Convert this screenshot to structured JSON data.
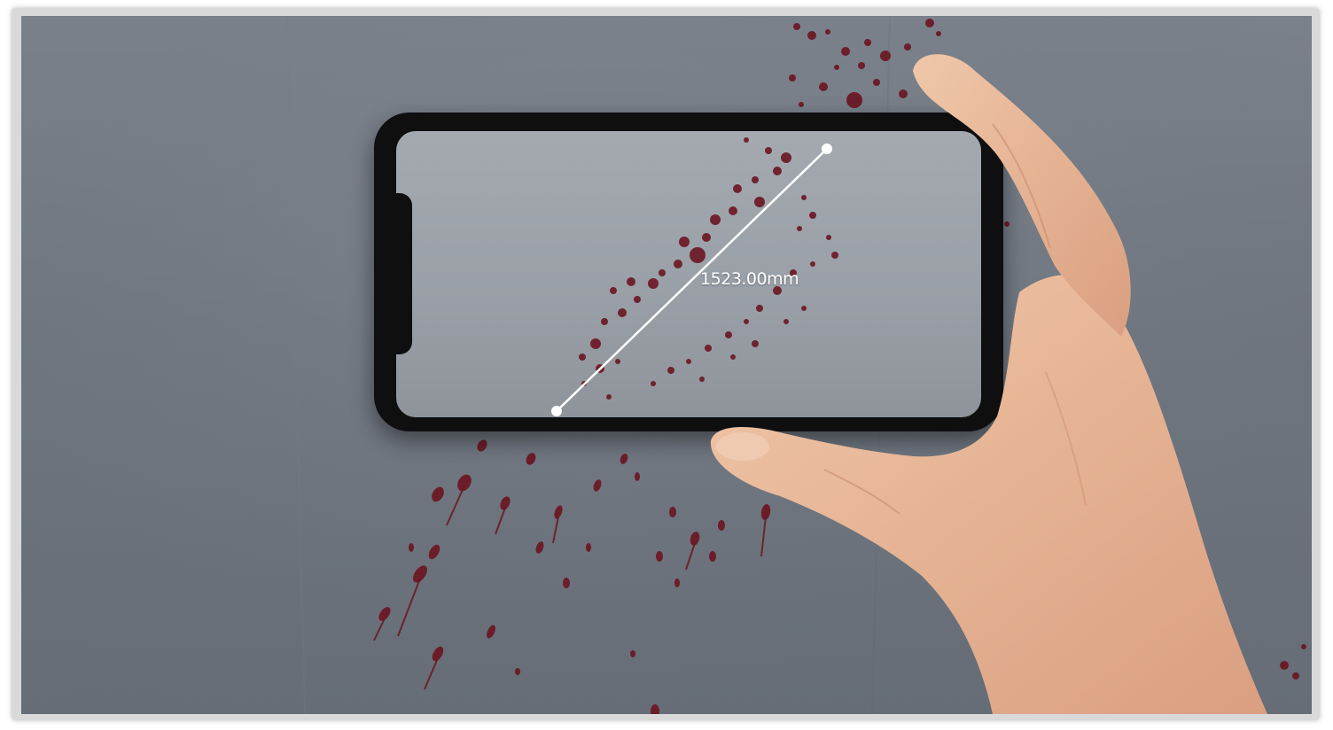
{
  "measurement": {
    "value": "1523.00mm"
  },
  "colors": {
    "wall": "#6f7680",
    "screen": "#9ea3aa",
    "phone_body": "#0f0f10",
    "blood": "#6b1622",
    "skin": "#e7b899",
    "measure_line": "#ffffff"
  },
  "icons": {
    "start_point": "measure-point-icon",
    "end_point": "measure-point-icon"
  }
}
